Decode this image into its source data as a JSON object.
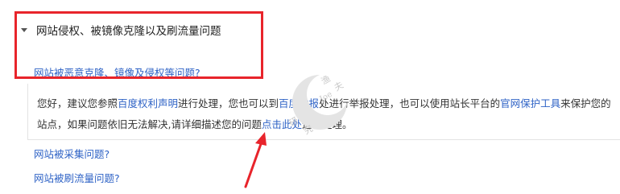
{
  "section": {
    "title": "网站侵权、被镜像克隆以及刷流量问题"
  },
  "questions": {
    "q1": "网站被恶意克隆、镜像及侵权等问题?",
    "q2": "网站被采集问题?",
    "q3": "网站被刷流量问题?"
  },
  "answer": {
    "part1": "您好，建议您参照",
    "link1": "百度权利声明",
    "part2": "进行处理，您也可以到",
    "link2": "百度举报",
    "part3": "处进行举报处理，也可以使用站长平台的",
    "link3": "官网保护工具",
    "part4": "来保护您的站点，如果问题依旧无法解决,请详细描述您的问题",
    "link4": "点击此处",
    "part5": "进行处理。"
  },
  "watermark": {
    "text1": "渔",
    "text2": "夫",
    "text3": "研",
    "text4": "究",
    "text5": "Joe"
  },
  "colors": {
    "highlight_border": "#e8242b",
    "link": "#2f63c6",
    "arrow": "#e8242b"
  }
}
